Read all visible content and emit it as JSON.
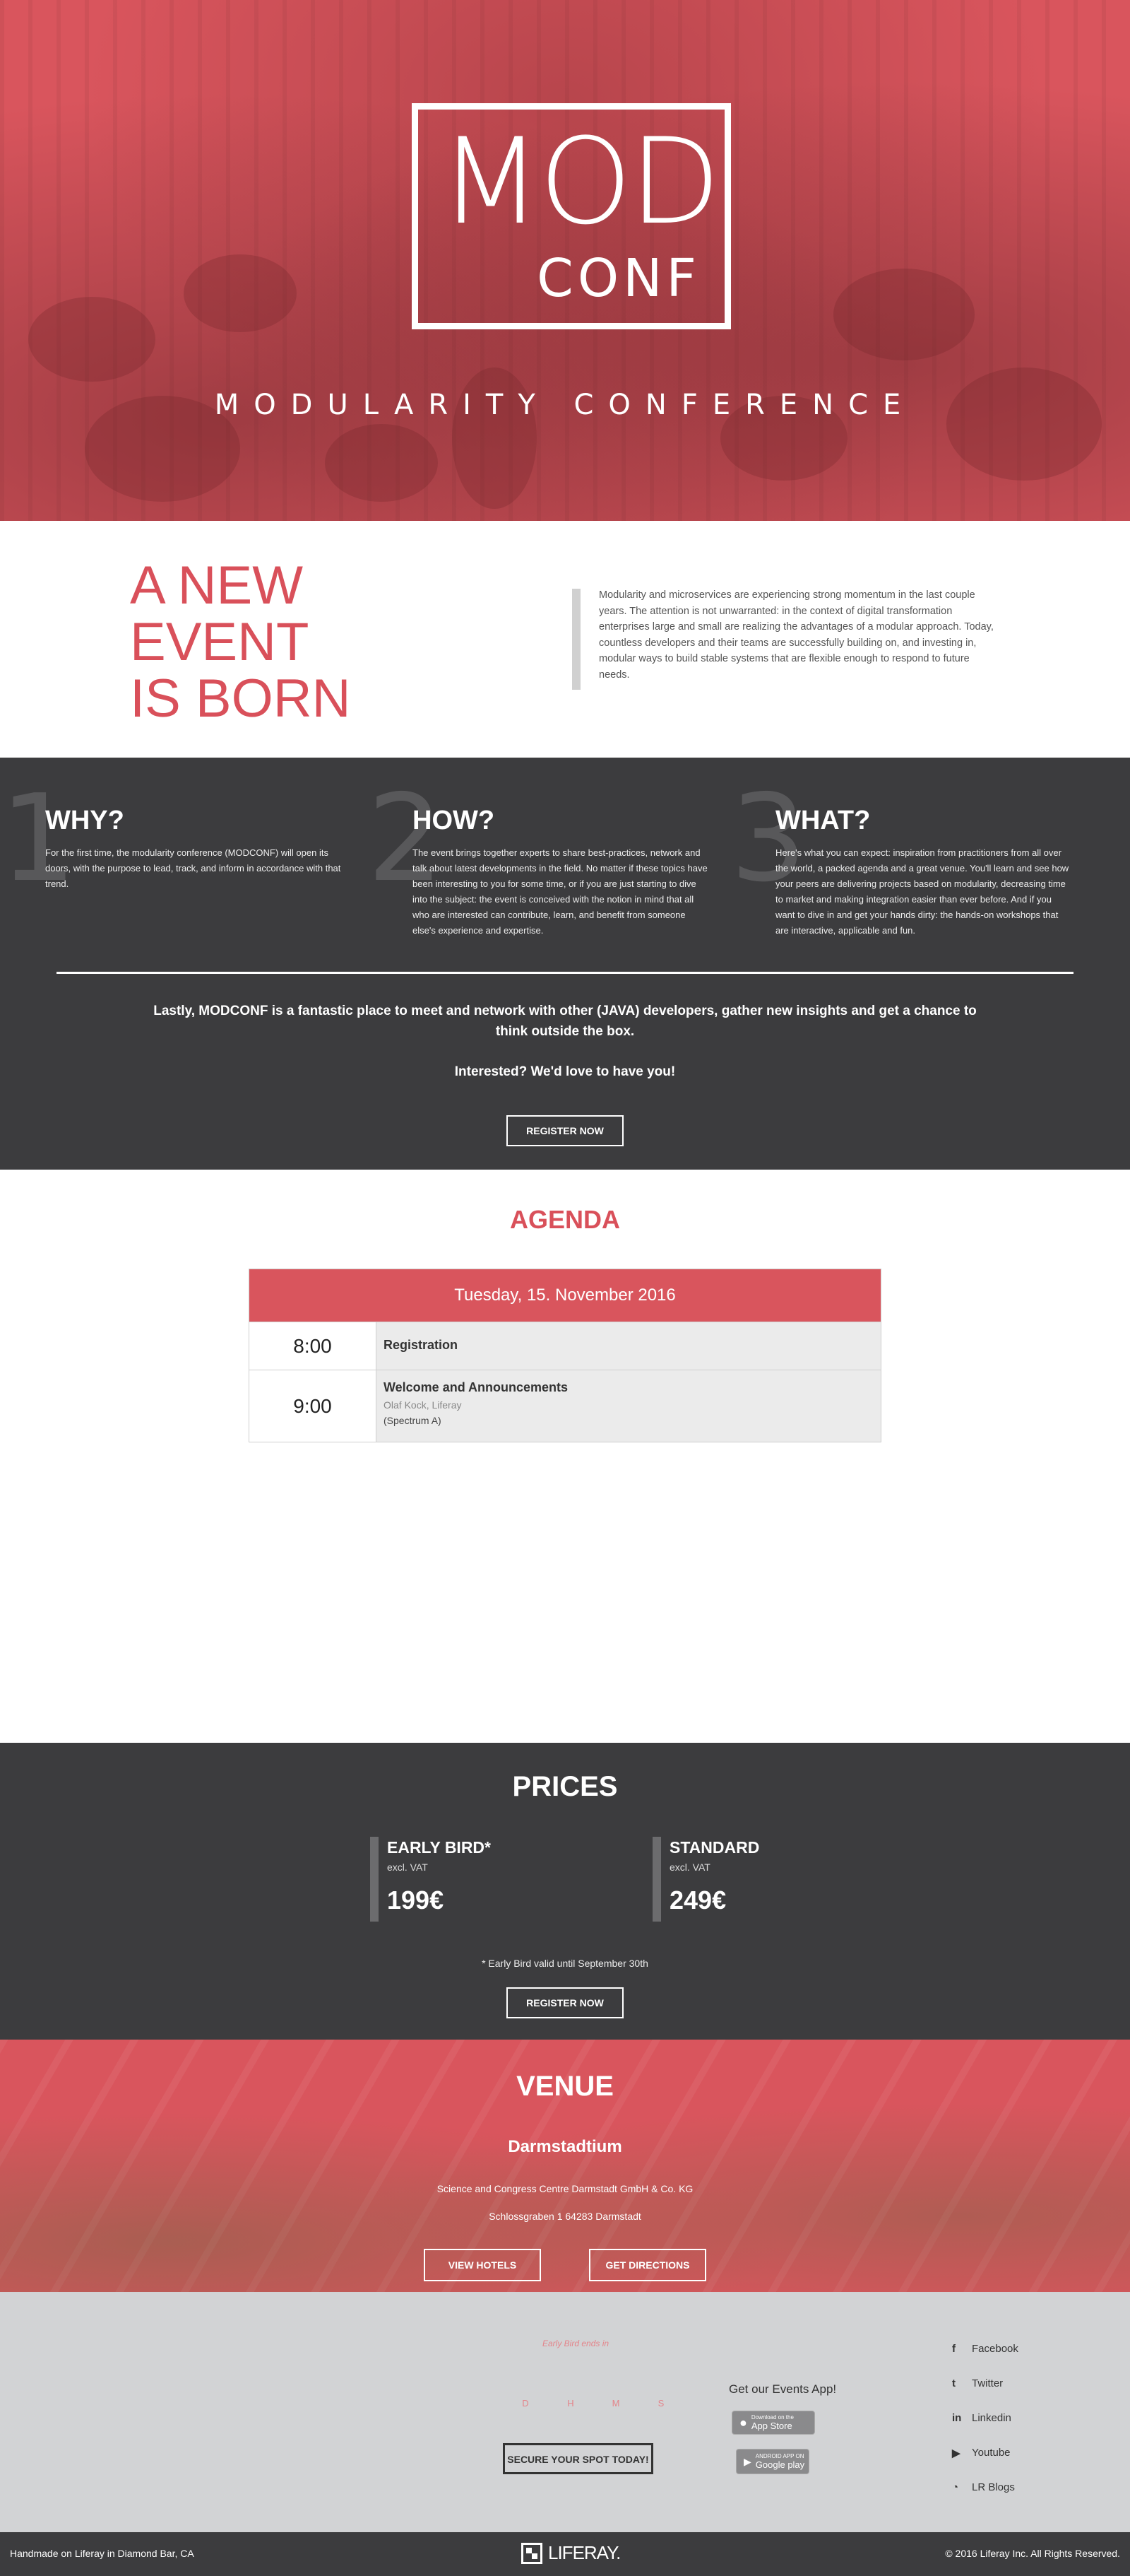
{
  "hero": {
    "logo_mod": "MOD",
    "logo_conf": "CONF",
    "subtitle": "MODULARITY CONFERENCE"
  },
  "intro": {
    "title_line1": "A NEW",
    "title_line2": "EVENT",
    "title_line3": "IS BORN",
    "text": "Modularity and microservices are experiencing strong momentum in the last couple years. The attention is not unwarranted: in the context of digital transformation enterprises large and small are realizing the advantages of a modular approach. Today, countless developers and their teams are successfully building on, and investing in, modular ways to build stable systems that are flexible enough to respond to future needs."
  },
  "about": {
    "columns": [
      {
        "num": "1",
        "title": "WHY?",
        "text": "For the first time, the modularity conference (MODCONF) will open its doors, with the purpose to lead, track, and inform in accordance with that trend."
      },
      {
        "num": "2",
        "title": "HOW?",
        "text": "The event brings together experts to share best-practices, network and talk about latest developments in the field. No matter if these topics have been interesting to you for some time, or if you are just starting to dive into the subject: the event is conceived with the notion in mind that all who are interested can contribute, learn, and benefit from someone else's experience and expertise."
      },
      {
        "num": "3",
        "title": "WHAT?",
        "text": "Here's what you can expect: inspiration from practitioners from all over the world, a packed agenda and a great venue. You'll learn and see how your peers are delivering projects based on modularity, decreasing time to market and making integration easier than ever before. And if you want to dive in and get your hands dirty: the hands-on workshops that are interactive, applicable and fun."
      }
    ],
    "lastly": "Lastly, MODCONF is a fantastic place to meet and network with other (JAVA) developers, gather new insights and get a chance to think outside the box.",
    "interested": "Interested? We'd love to have you!",
    "register_label": "REGISTER NOW"
  },
  "agenda": {
    "title": "AGENDA",
    "day": "Tuesday, 15. November 2016",
    "rows": [
      {
        "time": "8:00",
        "title": "Registration"
      },
      {
        "time": "9:00",
        "title": "Welcome and Announcements",
        "speaker": "Olaf Kock, Liferay",
        "room": "(Spectrum A)"
      }
    ]
  },
  "prices": {
    "title": "PRICES",
    "tiers": [
      {
        "name": "EARLY BIRD*",
        "vat": "excl. VAT",
        "amount": "199€"
      },
      {
        "name": "STANDARD",
        "vat": "excl. VAT",
        "amount": "249€"
      }
    ],
    "note": "* Early Bird valid until September 30th",
    "register_label": "REGISTER NOW"
  },
  "venue": {
    "title": "VENUE",
    "name": "Darmstadtium",
    "line1": "Science and Congress Centre Darmstadt GmbH & Co. KG",
    "line2": "Schlossgraben 1 64283 Darmstadt",
    "hotels_label": "VIEW HOTELS",
    "directions_label": "GET DIRECTIONS"
  },
  "footer": {
    "early_bird_ends": "Early Bird ends in",
    "countdown": [
      "D",
      "H",
      "M",
      "S"
    ],
    "secure_label": "SECURE YOUR SPOT TODAY!",
    "app_line": "Get our Events App!",
    "app_store_small": "Download on the",
    "app_store": "App Store",
    "google_small": "ANDROID APP ON",
    "google": "Google play",
    "social": [
      {
        "icon": "facebook-icon",
        "glyph": "f",
        "label": "Facebook"
      },
      {
        "icon": "twitter-icon",
        "glyph": "t",
        "label": "Twitter"
      },
      {
        "icon": "linkedin-icon",
        "glyph": "in",
        "label": "Linkedin"
      },
      {
        "icon": "youtube-icon",
        "glyph": "▶",
        "label": "Youtube"
      },
      {
        "icon": "rss-icon",
        "glyph": "◔",
        "label": "LR Blogs"
      }
    ],
    "handmade": "Handmade on Liferay in Diamond Bar, CA",
    "brand": "LIFERAY.",
    "copyright": "© 2016 Liferay Inc. All Rights Reserved."
  },
  "colors": {
    "accent": "#d9555d",
    "dark": "#3c3c3e",
    "grey": "#d2d3d5"
  }
}
